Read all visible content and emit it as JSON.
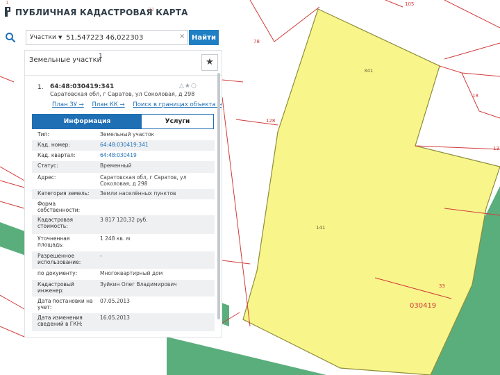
{
  "app": {
    "title": "ПУБЛИЧНАЯ КАДАСТРОВАЯ КАРТА",
    "corner_faint_1": "1",
    "corner_faint_2": "32"
  },
  "search": {
    "type_label": "Участки",
    "query": "51,547223 46,022303",
    "clear_glyph": "×",
    "button_label": "Найти"
  },
  "panel": {
    "title": "Земельные участки",
    "count": "1",
    "star_glyph": "★"
  },
  "result": {
    "index": "1.",
    "cadastral_number": "64:48:030419:341",
    "actions": "△★○",
    "address": "Саратовская обл, г Саратов, ул Соколовая, д 298",
    "links": [
      "План ЗУ →",
      "План КК →",
      "Поиск в границах объекта →"
    ]
  },
  "tabs": {
    "info": "Информация",
    "services": "Услуги"
  },
  "info_rows": [
    {
      "key": "Тип:",
      "value": "Земельный участок"
    },
    {
      "key": "Кад. номер:",
      "value": "64:48:030419:341"
    },
    {
      "key": "Кад. квартал:",
      "value": "64:48:030419"
    },
    {
      "key": "Статус:",
      "value": "Временный"
    },
    {
      "key": "Адрес:",
      "value": "Саратовская обл, г Саратов, ул Соколовая, д 298"
    },
    {
      "key": "Категория земель:",
      "value": "Земли населённых пунктов"
    },
    {
      "key": "Форма собственности:",
      "value": ""
    },
    {
      "key": "Кадастровая стоимость:",
      "value": "3 817 120,32 руб."
    },
    {
      "key": "Уточненная площадь:",
      "value": "1 248 кв. м"
    },
    {
      "key": "Разрешенное использование:",
      "value": "-"
    },
    {
      "key": "по документу:",
      "value": "Многоквартирный дом"
    },
    {
      "key": "Кадастровый инженер:",
      "value": "Зуйкин Олег Владимирович"
    },
    {
      "key": "Дата постановки на учет:",
      "value": "07.05.2013"
    },
    {
      "key": "Дата изменения сведений в ГКН:",
      "value": "16.05.2013"
    }
  ],
  "map_labels": {
    "l1": "105",
    "l2": "78",
    "l3": "341",
    "l4": "18",
    "l5": "128",
    "l6": "13",
    "l7": "141",
    "l8": "33",
    "l9": "030419"
  },
  "colors": {
    "accent": "#1f6fb5",
    "search_button": "#1f7fc5",
    "parcel_fill": "#f8f58a",
    "parcel_stroke": "#8d8c3a",
    "green_zone": "#5aae7c",
    "boundary": "#d23a3a"
  }
}
